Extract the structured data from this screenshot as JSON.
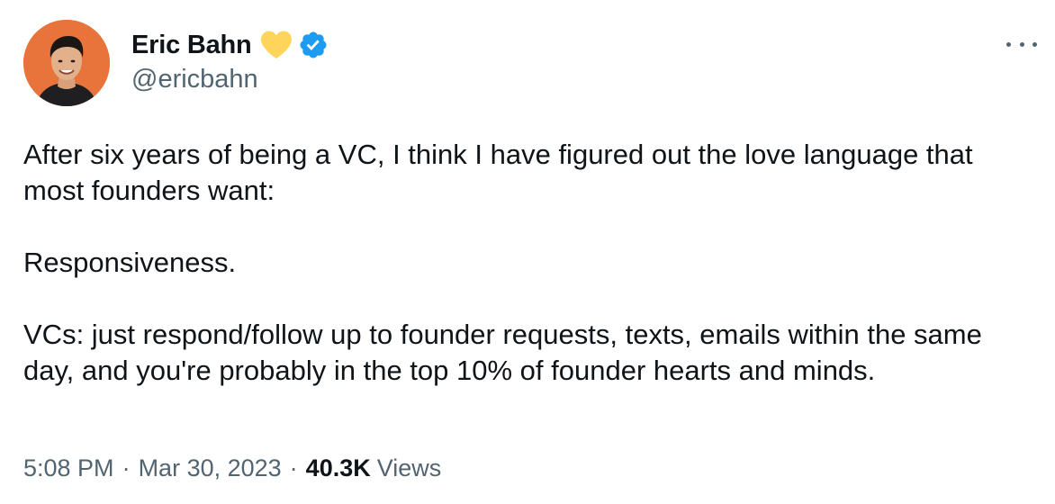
{
  "author": {
    "display_name": "Eric Bahn",
    "handle": "@ericbahn",
    "avatar_background": "#e8743b",
    "badges": [
      "yellow-heart-icon",
      "verified-icon"
    ],
    "heart_color": "#ffd45b",
    "verified_color": "#1d9bf0"
  },
  "actions": {
    "more_icon": "more-icon"
  },
  "tweet": {
    "paragraphs": [
      "After six years of being a VC, I think I have figured out the love language that most founders want:",
      "Responsiveness.",
      "VCs: just respond/follow up to founder requests, texts, emails within the same day, and you're probably in the top 10% of founder hearts and minds."
    ]
  },
  "meta": {
    "time": "5:08 PM",
    "separator": "·",
    "date": "Mar 30, 2023",
    "views_count": "40.3K",
    "views_label": "Views"
  }
}
